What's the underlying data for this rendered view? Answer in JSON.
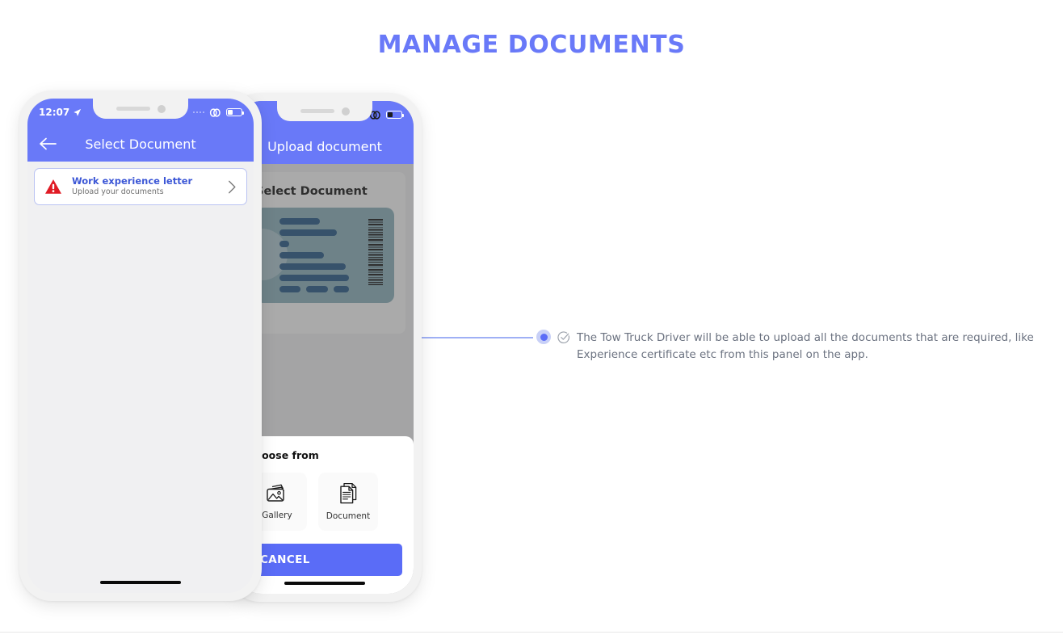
{
  "header": {
    "title": "MANAGE DOCUMENTS",
    "accent_color": "#6979F8"
  },
  "phone_one": {
    "status_bar": {
      "time": "12:07",
      "location_icon": "location-arrow-icon",
      "signal_icon": "signal-dots-icon",
      "wifi_icon": "wifi-link-icon",
      "battery_icon": "battery-icon"
    },
    "app_bar": {
      "back_icon": "back-arrow-icon",
      "title": "Select Document"
    },
    "document_card": {
      "warning_icon": "warning-triangle-icon",
      "title": "Work experience letter",
      "subtitle": "Upload your documents",
      "chevron_icon": "chevron-right-icon"
    }
  },
  "phone_two": {
    "status_bar": {
      "signal_icon": "signal-dots-icon",
      "wifi_icon": "wifi-link-icon",
      "battery_icon": "battery-icon"
    },
    "app_bar": {
      "title": "Upload document"
    },
    "panel": {
      "title": "Select Document",
      "illustration": "id-card-illustration"
    },
    "bottom_sheet": {
      "title": "Choose from",
      "options": [
        {
          "label": "Gallery",
          "icon": "gallery-icon"
        },
        {
          "label": "Document",
          "icon": "document-icon"
        }
      ],
      "cancel_label": "CANCEL"
    }
  },
  "annotation": {
    "marker_icon": "bullet-dot-marker",
    "check_icon": "check-circle-icon",
    "text": "The Tow Truck Driver will be able to upload all the documents that are required, like Experience certificate etc from this panel on the app."
  }
}
